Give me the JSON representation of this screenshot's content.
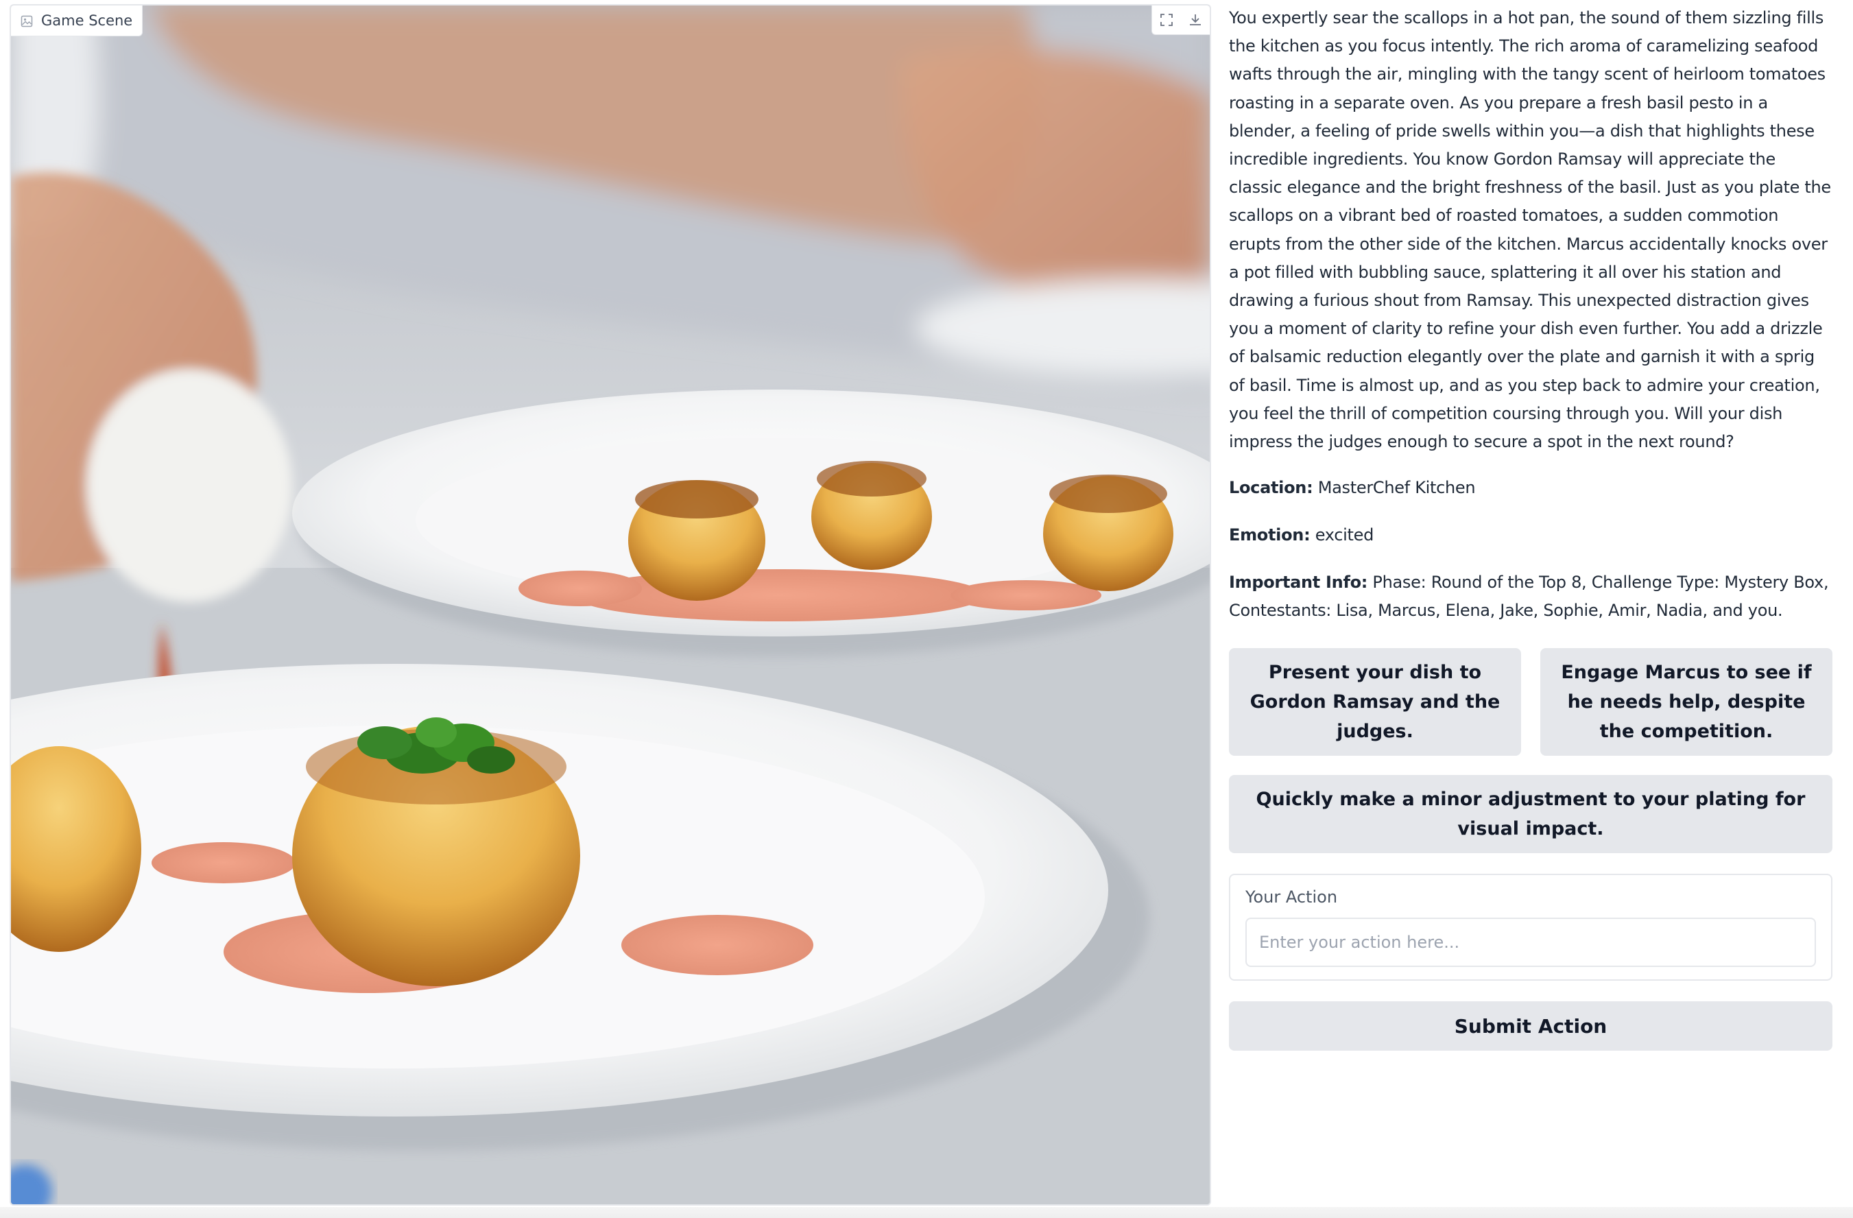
{
  "image_panel": {
    "label": "Game Scene",
    "label_icon": "image-icon",
    "tools": [
      {
        "name": "fullscreen-icon"
      },
      {
        "name": "download-icon"
      }
    ]
  },
  "story": {
    "narrative": "You expertly sear the scallops in a hot pan, the sound of them sizzling fills the kitchen as you focus intently. The rich aroma of caramelizing seafood wafts through the air, mingling with the tangy scent of heirloom tomatoes roasting in a separate oven. As you prepare a fresh basil pesto in a blender, a feeling of pride swells within you—a dish that highlights these incredible ingredients. You know Gordon Ramsay will appreciate the classic elegance and the bright freshness of the basil. Just as you plate the scallops on a vibrant bed of roasted tomatoes, a sudden commotion erupts from the other side of the kitchen. Marcus accidentally knocks over a pot filled with bubbling sauce, splattering it all over his station and drawing a furious shout from Ramsay. This unexpected distraction gives you a moment of clarity to refine your dish even further. You add a drizzle of balsamic reduction elegantly over the plate and garnish it with a sprig of basil. Time is almost up, and as you step back to admire your creation, you feel the thrill of competition coursing through you. Will your dish impress the judges enough to secure a spot in the next round?",
    "location_label": "Location:",
    "location_value": "MasterChef Kitchen",
    "emotion_label": "Emotion:",
    "emotion_value": "excited",
    "info_label": "Important Info:",
    "info_value": "Phase: Round of the Top 8, Challenge Type: Mystery Box, Contestants: Lisa, Marcus, Elena, Jake, Sophie, Amir, Nadia, and you."
  },
  "choices": [
    "Present your dish to Gordon Ramsay and the judges.",
    "Engage Marcus to see if he needs help, despite the competition.",
    "Quickly make a minor adjustment to your plating for visual impact."
  ],
  "action": {
    "label": "Your Action",
    "placeholder": "Enter your action here...",
    "value": ""
  },
  "submit_label": "Submit Action",
  "colors": {
    "button_bg": "#e5e7eb",
    "border": "#e5e7eb",
    "text": "#1f2937",
    "placeholder": "#9ca3af"
  }
}
